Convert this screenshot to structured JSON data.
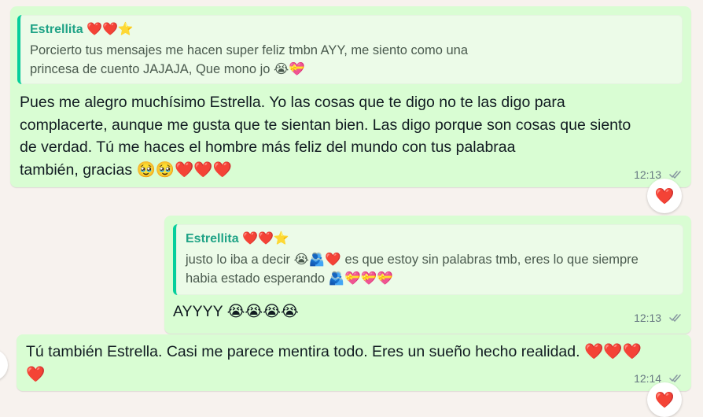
{
  "messages": [
    {
      "quote": {
        "sender": "Estrellita ❤️❤️⭐",
        "text": "Porcierto tus mensajes me hacen super feliz tmbn AYY, me siento como una\nprincesa de cuento JAJAJA, Que mono jo 😭💝"
      },
      "text": "Pues me alegro muchísimo Estrella. Yo las cosas que te digo no te las digo para\ncomplacerte, aunque me gusta que te sientan bien. Las digo porque son cosas que siento\nde verdad. Tú me haces el hombre más feliz del mundo con tus palabraa\ntambién, gracias 🥹🥹❤️❤️❤️",
      "time": "12:13",
      "reaction": "❤️"
    },
    {
      "quote": {
        "sender": "Estrellita ❤️❤️⭐",
        "text": "justo lo iba a decir 😭🫂❤️ es que estoy sin palabras tmb, eres lo que siempre\nhabia estado esperando 🫂💝💝💝"
      },
      "text": "AYYYY 😭😭😭😭",
      "time": "12:13"
    },
    {
      "text": "Tú también Estrella. Casi me parece mentira todo. Eres un sueño hecho realidad. ❤️❤️❤️\n❤️",
      "time": "12:14",
      "reaction": "❤️"
    }
  ],
  "status_icon": "double-check-icon",
  "colors": {
    "bubble": "#d9fdd3",
    "quote_bar": "#06cf9c",
    "quote_name": "#1fa386",
    "background": "#f7f2ee"
  }
}
